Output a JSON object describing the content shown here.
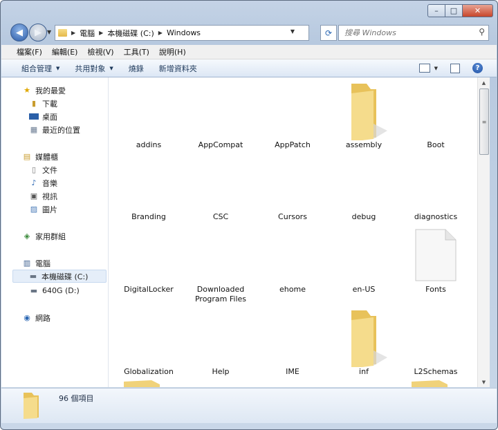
{
  "window": {
    "caption_buttons": {
      "minimize": "–",
      "maximize": "□",
      "close": "✕"
    }
  },
  "address": {
    "crumbs": [
      "電腦",
      "本機磁碟 (C:)",
      "Windows"
    ],
    "search_placeholder": "搜尋 Windows"
  },
  "menu": [
    "檔案(F)",
    "編輯(E)",
    "檢視(V)",
    "工具(T)",
    "說明(H)"
  ],
  "toolbar": {
    "organize": "組合管理",
    "share": "共用對象",
    "burn": "燒錄",
    "new_folder": "新增資料夾",
    "help": "?"
  },
  "sidebar": {
    "favorites": {
      "label": "我的最愛",
      "items": [
        "下載",
        "桌面",
        "最近的位置"
      ]
    },
    "libraries": {
      "label": "媒體櫃",
      "items": [
        "文件",
        "音樂",
        "視訊",
        "圖片"
      ]
    },
    "homegroup": "家用群組",
    "computer": {
      "label": "電腦",
      "items": [
        "本機磁碟 (C:)",
        "640G (D:)"
      ]
    },
    "network": "網路"
  },
  "files": [
    {
      "name": "addins",
      "icon": "folder-icon"
    },
    {
      "name": "AppCompat",
      "icon": "folder-icon"
    },
    {
      "name": "AppPatch",
      "icon": "folder-icon"
    },
    {
      "name": "assembly",
      "icon": "folder-icon"
    },
    {
      "name": "Boot",
      "icon": "folder-icon"
    },
    {
      "name": "Branding",
      "icon": "folder-icon"
    },
    {
      "name": "CSC",
      "icon": "folder-icon"
    },
    {
      "name": "Cursors",
      "icon": "folder-icon"
    },
    {
      "name": "debug",
      "icon": "folder-icon"
    },
    {
      "name": "diagnostics",
      "icon": "folder-icon"
    },
    {
      "name": "DigitalLocker",
      "icon": "folder-icon"
    },
    {
      "name": "Downloaded Program Files",
      "icon": "folder-icon"
    },
    {
      "name": "ehome",
      "icon": "folder-icon"
    },
    {
      "name": "en-US",
      "icon": "folder-icon"
    },
    {
      "name": "Fonts",
      "icon": "document-icon"
    },
    {
      "name": "Globalization",
      "icon": "folder-icon"
    },
    {
      "name": "Help",
      "icon": "folder-icon"
    },
    {
      "name": "IME",
      "icon": "folder-icon"
    },
    {
      "name": "inf",
      "icon": "folder-icon"
    },
    {
      "name": "L2Schemas",
      "icon": "folder-icon"
    }
  ],
  "status": {
    "count": "96 個項目"
  }
}
